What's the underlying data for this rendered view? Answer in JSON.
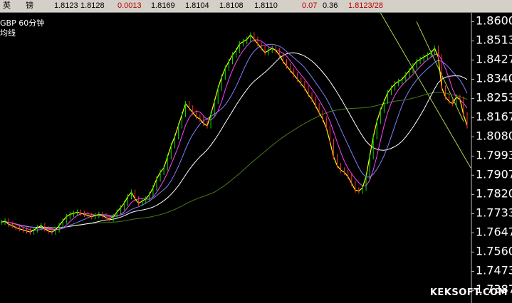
{
  "quote_bar": {
    "name_char1": "英",
    "name_char2": "镑",
    "open": "1.8123",
    "ask": "1.8128",
    "change": "0.0013",
    "high": "1.8169",
    "low": "1.8104",
    "prev": "1.8108",
    "v1": "1.8110",
    "change_pct": "0.07",
    "v2": "0.36",
    "last": "1.8123/28"
  },
  "chart_header": {
    "symbol_period": "GBP  60分钟",
    "indicator": "均线"
  },
  "watermark": "KEKSOFT.COM",
  "colors": {
    "price": "#ffff00",
    "change": "#ff3030",
    "ma_fast": "#ff40ff",
    "ma_mid": "#8080ff",
    "ma_slow": "#ffffff",
    "ma_long": "#4a7a1a",
    "trendline": "#a8d848",
    "axis_text": "#ffffff"
  },
  "chart_data": {
    "type": "line",
    "title": "",
    "xlabel": "",
    "ylabel": "",
    "ylim": [
      1.733,
      1.864
    ],
    "yticks": [
      "1.8600",
      "1.8513",
      "1.8427",
      "1.8340",
      "1.8253",
      "1.8167",
      "1.8080",
      "1.7993",
      "1.7907",
      "1.7820",
      "1.7733",
      "1.7647",
      "1.7560",
      "1.7473",
      "1.7387"
    ],
    "x_count": 130,
    "close": [
      1.7695,
      1.77,
      1.7685,
      1.768,
      1.767,
      1.7665,
      1.766,
      1.7655,
      1.765,
      1.766,
      1.767,
      1.768,
      1.7665,
      1.7655,
      1.765,
      1.766,
      1.768,
      1.77,
      1.772,
      1.773,
      1.7735,
      1.774,
      1.7735,
      1.773,
      1.7725,
      1.772,
      1.7725,
      1.773,
      1.7725,
      1.7715,
      1.771,
      1.772,
      1.774,
      1.776,
      1.778,
      1.781,
      1.783,
      1.78,
      1.778,
      1.779,
      1.78,
      1.782,
      1.785,
      1.789,
      1.792,
      1.794,
      1.799,
      1.804,
      1.808,
      1.813,
      1.818,
      1.823,
      1.821,
      1.819,
      1.817,
      1.816,
      1.814,
      1.813,
      1.818,
      1.824,
      1.83,
      1.835,
      1.839,
      1.842,
      1.845,
      1.847,
      1.85,
      1.851,
      1.852,
      1.854,
      1.852,
      1.85,
      1.848,
      1.846,
      1.847,
      1.848,
      1.847,
      1.845,
      1.842,
      1.84,
      1.838,
      1.836,
      1.834,
      1.832,
      1.83,
      1.827,
      1.825,
      1.822,
      1.819,
      1.816,
      1.812,
      1.806,
      1.799,
      1.795,
      1.793,
      1.792,
      1.79,
      1.787,
      1.784,
      1.7835,
      1.785,
      1.79,
      1.799,
      1.808,
      1.815,
      1.82,
      1.824,
      1.828,
      1.83,
      1.832,
      1.833,
      1.834,
      1.836,
      1.838,
      1.84,
      1.842,
      1.843,
      1.844,
      1.845,
      1.846,
      1.848,
      1.844,
      1.83,
      1.826,
      1.824,
      1.823,
      1.826,
      1.825,
      1.818,
      1.813
    ],
    "series": [
      {
        "role": "price",
        "color": "#ffff00",
        "field": "close"
      },
      {
        "role": "ma_fast",
        "color": "#ff40ff",
        "period": 5
      },
      {
        "role": "ma_mid",
        "color": "#8080ff",
        "period": 10
      },
      {
        "role": "ma_slow",
        "color": "#ffffff",
        "period": 20
      },
      {
        "role": "ma_long",
        "color": "#4a7a1a",
        "period": 60
      }
    ],
    "trendlines": [
      {
        "from": [
          105,
          1.864
        ],
        "to": [
          130,
          1.794
        ]
      },
      {
        "from": [
          115,
          1.86
        ],
        "to": [
          128,
          1.815
        ]
      }
    ],
    "grid": false,
    "legend": "none"
  }
}
